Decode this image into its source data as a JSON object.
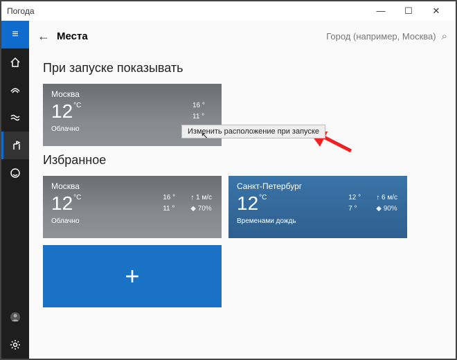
{
  "window": {
    "title": "Погода",
    "min": "—",
    "max": "☐",
    "close": "✕"
  },
  "sidebar": {
    "hamburger": "≡"
  },
  "header": {
    "back": "←",
    "title": "Места",
    "search_placeholder": "Город (например, Москва)",
    "search_icon": "⌕"
  },
  "sections": {
    "startup": "При запуске показывать",
    "favorites": "Избранное"
  },
  "tiles": {
    "startup": {
      "city": "Москва",
      "temp": "12",
      "unit": "°C",
      "cond": "Облачно",
      "high": "16 °",
      "low": "11 °"
    },
    "fav1": {
      "city": "Москва",
      "temp": "12",
      "unit": "°C",
      "cond": "Облачно",
      "high": "16 °",
      "low": "11 °",
      "wind": "↑ 1 м/с",
      "humidity": "◆ 70%"
    },
    "fav2": {
      "city": "Санкт-Петербург",
      "temp": "12",
      "unit": "°C",
      "cond": "Временами дождь",
      "high": "12 °",
      "low": "7 °",
      "wind": "↑ 6 м/с",
      "humidity": "◆ 90%"
    },
    "add": "+"
  },
  "tooltip": "Изменить расположение при запуске"
}
